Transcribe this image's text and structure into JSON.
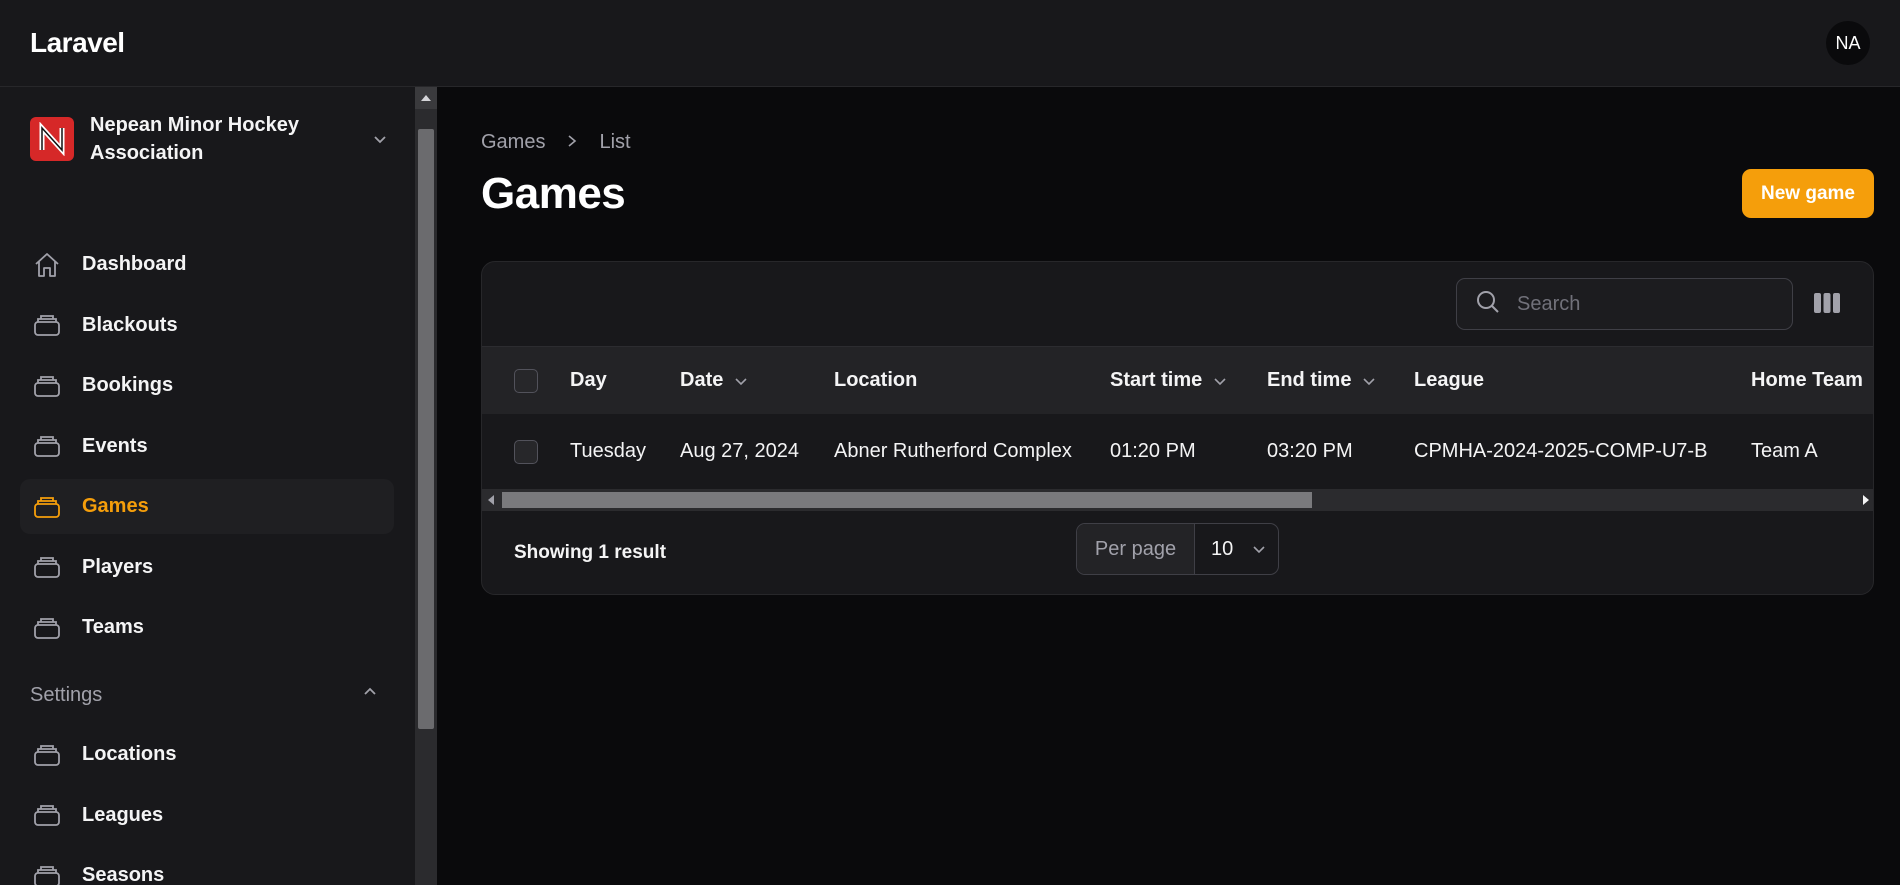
{
  "app": {
    "brand": "Laravel",
    "user_initials": "NA"
  },
  "tenant": {
    "name": "Nepean Minor Hockey Association"
  },
  "nav": [
    {
      "label": "Dashboard",
      "icon": "home-icon",
      "active": false
    },
    {
      "label": "Blackouts",
      "icon": "stack-icon",
      "active": false
    },
    {
      "label": "Bookings",
      "icon": "stack-icon",
      "active": false
    },
    {
      "label": "Events",
      "icon": "stack-icon",
      "active": false
    },
    {
      "label": "Games",
      "icon": "stack-icon",
      "active": true
    },
    {
      "label": "Players",
      "icon": "stack-icon",
      "active": false
    },
    {
      "label": "Teams",
      "icon": "stack-icon",
      "active": false
    }
  ],
  "settings_group": {
    "label": "Settings",
    "items": [
      {
        "label": "Locations",
        "icon": "stack-icon"
      },
      {
        "label": "Leagues",
        "icon": "stack-icon"
      },
      {
        "label": "Seasons",
        "icon": "stack-icon"
      }
    ]
  },
  "breadcrumb": {
    "parent": "Games",
    "current": "List"
  },
  "page": {
    "title": "Games",
    "new_button": "New game"
  },
  "table": {
    "search_placeholder": "Search",
    "columns": [
      "Day",
      "Date",
      "Location",
      "Start time",
      "End time",
      "League",
      "Home Team"
    ],
    "rows": [
      [
        "Tuesday",
        "Aug 27, 2024",
        "Abner Rutherford Complex",
        "01:20 PM",
        "03:20 PM",
        "CPMHA-2024-2025-COMP-U7-B",
        "Team A"
      ]
    ],
    "footer": {
      "result_text": "Showing 1 result",
      "per_page_label": "Per page",
      "per_page_value": "10"
    }
  },
  "colors": {
    "accent": "#f59e0b",
    "background": "#0a0a0c",
    "surface": "#18181b"
  }
}
